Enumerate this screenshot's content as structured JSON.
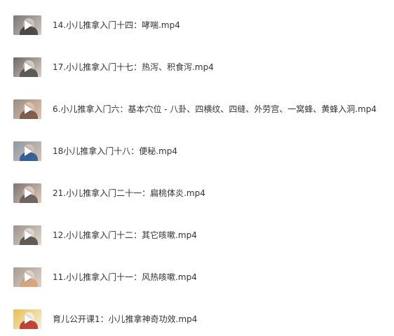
{
  "files": [
    {
      "name": "14.小儿推拿入门十四：哮喘.mp4",
      "thumbnail_icon": "video-thumbnail",
      "thumb_colors": [
        "#7d7570",
        "#cfc9c3",
        "#4a4540"
      ]
    },
    {
      "name": "17.小儿推拿入门十七：热泻、积食泻.mp4",
      "thumbnail_icon": "video-thumbnail",
      "thumb_colors": [
        "#6e6862",
        "#d8d0c8",
        "#5a5550"
      ]
    },
    {
      "name": "6.小儿推拿入门六：基本穴位 - 八卦、四横纹、四缝、外劳宫、一窝蜂、黄蜂入洞.mp4",
      "thumbnail_icon": "video-thumbnail",
      "thumb_colors": [
        "#9a8c82",
        "#e2c4b0",
        "#7a5a48"
      ]
    },
    {
      "name": "18小儿推拿入门十八：便秘.mp4",
      "thumbnail_icon": "video-thumbnail",
      "thumb_colors": [
        "#8d99a8",
        "#d7c2b2",
        "#2d5d9a"
      ]
    },
    {
      "name": "21.小儿推拿入门二十一：扁桃体炎.mp4",
      "thumbnail_icon": "video-thumbnail",
      "thumb_colors": [
        "#7c756f",
        "#e0ccbe",
        "#6a625c"
      ]
    },
    {
      "name": "12.小儿推拿入门十二：其它咳嗽.mp4",
      "thumbnail_icon": "video-thumbnail",
      "thumb_colors": [
        "#9c938b",
        "#e3d8cf",
        "#5c544e"
      ]
    },
    {
      "name": "11.小儿推拿入门十一：风热咳嗽.mp4",
      "thumbnail_icon": "video-thumbnail",
      "thumb_colors": [
        "#a69c93",
        "#e1d3c8",
        "#d7a37a"
      ]
    },
    {
      "name": "育儿公开课1：小儿推拿神奇功效.mp4",
      "thumbnail_icon": "video-thumbnail",
      "thumb_colors": [
        "#e6c14a",
        "#f4efe6",
        "#c0392b"
      ]
    }
  ],
  "play_icon": "play-icon"
}
